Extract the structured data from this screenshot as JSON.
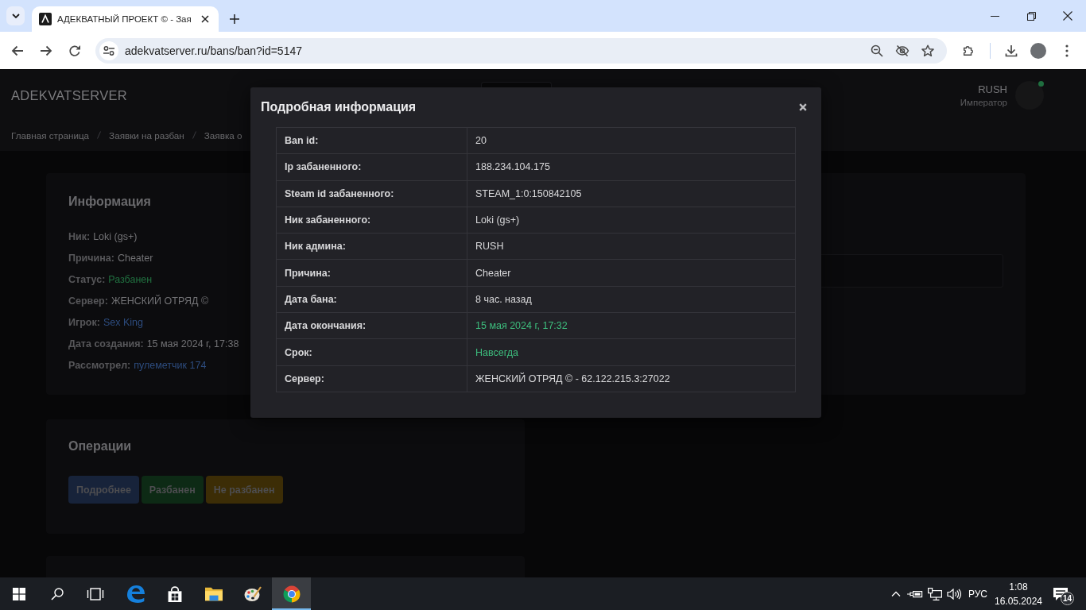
{
  "browser": {
    "tab": {
      "title": "АДЕКВАТНЫЙ ПРОЕКТ © - Зая"
    },
    "address": "adekvatserver.ru/bans/ban?id=5147"
  },
  "header": {
    "logo": "ADEKVATSERVER",
    "user": {
      "name": "RUSH",
      "role": "Император",
      "online": true
    }
  },
  "breadcrumbs": [
    "Главная страница",
    "Заявки на разбан",
    "Заявка о"
  ],
  "info": {
    "title": "Информация",
    "fields": [
      {
        "label": "Ник:",
        "value": "Loki (gs+)",
        "kind": "text"
      },
      {
        "label": "Причина:",
        "value": "Cheater",
        "kind": "text"
      },
      {
        "label": "Статус:",
        "value": "Разбанен",
        "kind": "status"
      },
      {
        "label": "Сервер:",
        "value": "ЖЕНСКИЙ ОТРЯД ©",
        "kind": "text"
      },
      {
        "label": "Игрок:",
        "value": "Sex King",
        "kind": "link"
      },
      {
        "label": "Дата создания:",
        "value": "15 мая 2024 г, 17:38",
        "kind": "text"
      },
      {
        "label": "Рассмотрел:",
        "value": "пулеметчик 174",
        "kind": "link"
      }
    ]
  },
  "operations": {
    "title": "Операции",
    "buttons": [
      {
        "label": "Подробнее",
        "color": "#17233a"
      },
      {
        "label": "Разбанен",
        "color": "#0d2a15"
      },
      {
        "label": "Не разбанен",
        "color": "#3c2d06"
      }
    ]
  },
  "modal": {
    "title": "Подробная информация",
    "rows": [
      {
        "label": "Ban id:",
        "value": "20",
        "kind": "text"
      },
      {
        "label": "Ip забаненного:",
        "value": "188.234.104.175",
        "kind": "text"
      },
      {
        "label": "Steam id забаненного:",
        "value": "STEAM_1:0:150842105",
        "kind": "text"
      },
      {
        "label": "Ник забаненного:",
        "value": "Loki (gs+)",
        "kind": "text"
      },
      {
        "label": "Ник админа:",
        "value": "RUSH",
        "kind": "text"
      },
      {
        "label": "Причина:",
        "value": "Cheater",
        "kind": "text"
      },
      {
        "label": "Дата бана:",
        "value": "8 час. назад",
        "kind": "text"
      },
      {
        "label": "Дата окончания:",
        "value": "15 мая 2024 г, 17:32",
        "kind": "success"
      },
      {
        "label": "Срок:",
        "value": "Навсегда",
        "kind": "success"
      },
      {
        "label": "Сервер:",
        "value": "ЖЕНСКИЙ ОТРЯД © - 62.122.215.3:27022",
        "kind": "text"
      }
    ]
  },
  "taskbar": {
    "apps": [
      {
        "selected": false
      },
      {
        "selected": false
      },
      {
        "selected": false
      },
      {
        "selected": false
      },
      {
        "selected": true
      }
    ],
    "language": "РУС",
    "time": "1:08",
    "date": "16.05.2024",
    "notifications": "14"
  }
}
